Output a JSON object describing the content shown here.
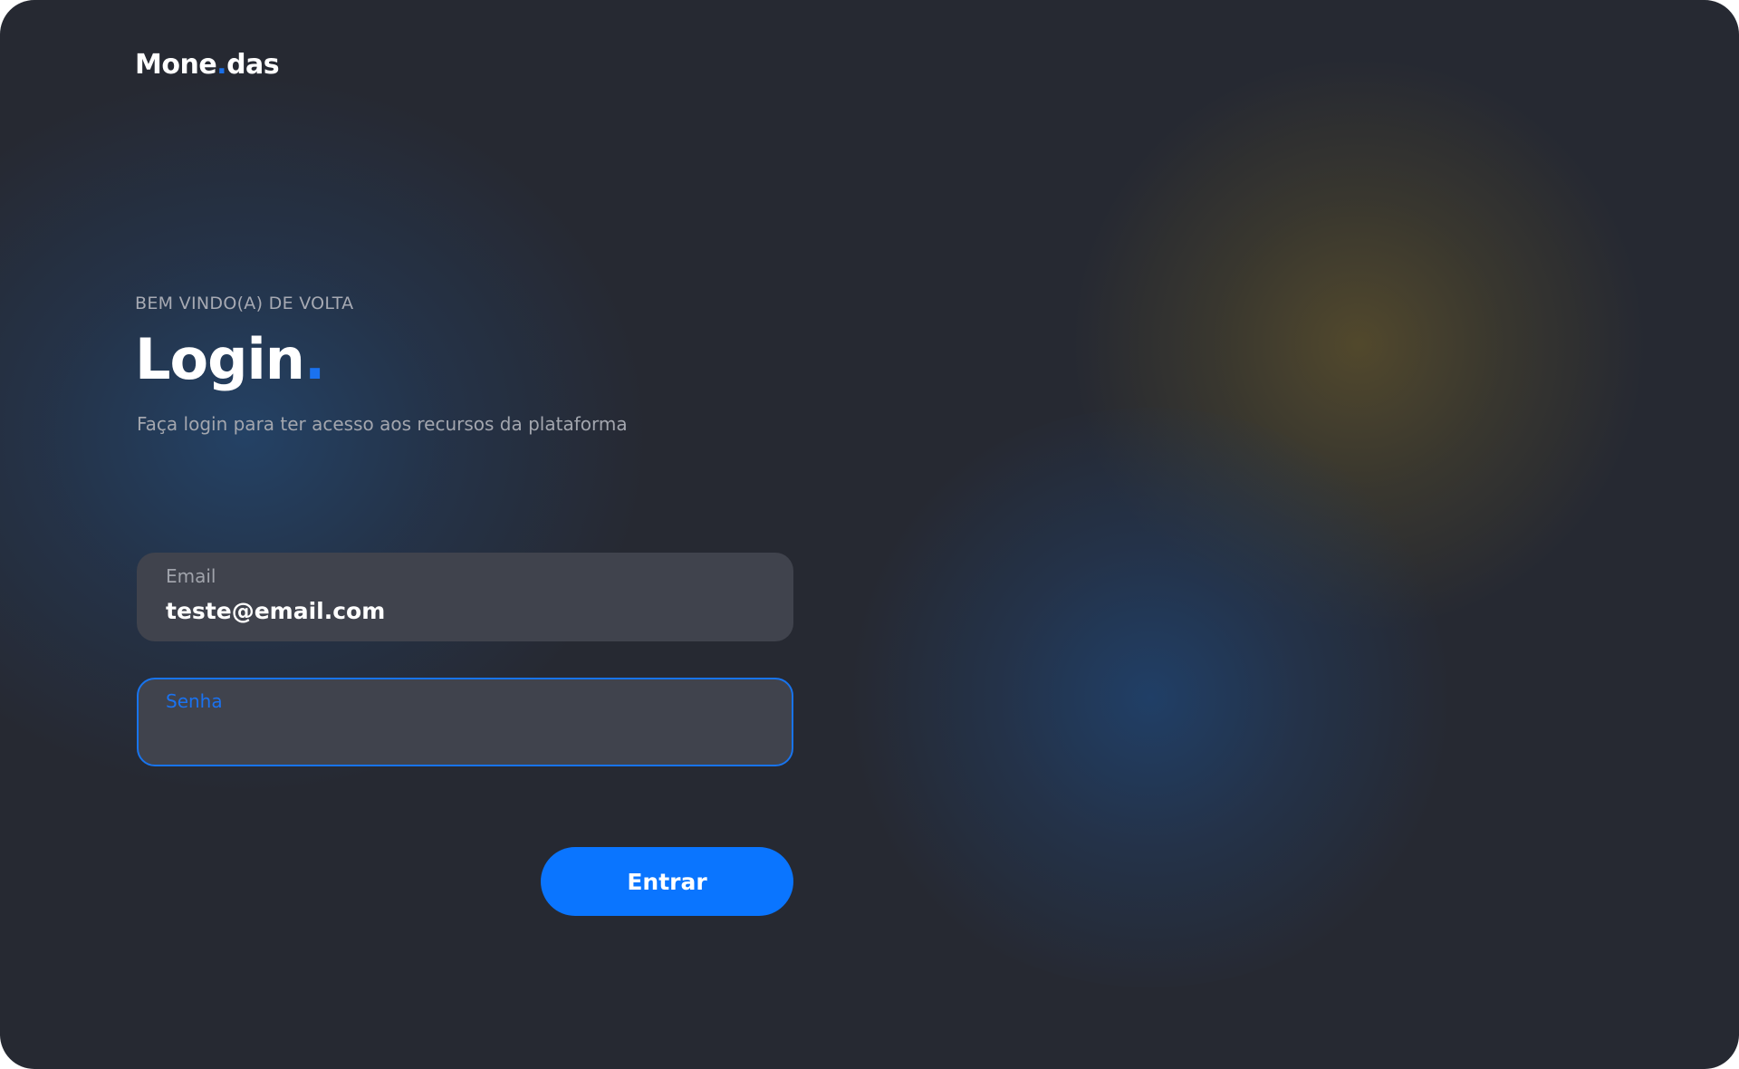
{
  "brand": {
    "name_start": "Mone",
    "name_dot": ".",
    "name_end": "das"
  },
  "login": {
    "eyebrow": "BEM VINDO(A) DE VOLTA",
    "title": "Login",
    "title_dot": ".",
    "subtitle": "Faça login para ter acesso aos recursos da plataforma"
  },
  "form": {
    "email": {
      "label": "Email",
      "value": "teste@email.com"
    },
    "password": {
      "label": "Senha",
      "value": "",
      "focused": true
    },
    "submit_label": "Entrar"
  },
  "colors": {
    "background": "#262932",
    "accent": "#0a75ff",
    "field_background": "#40434d",
    "muted_text": "#a3a6ae",
    "glow_yellow": "#544a2c",
    "glow_blue": "#204069"
  }
}
